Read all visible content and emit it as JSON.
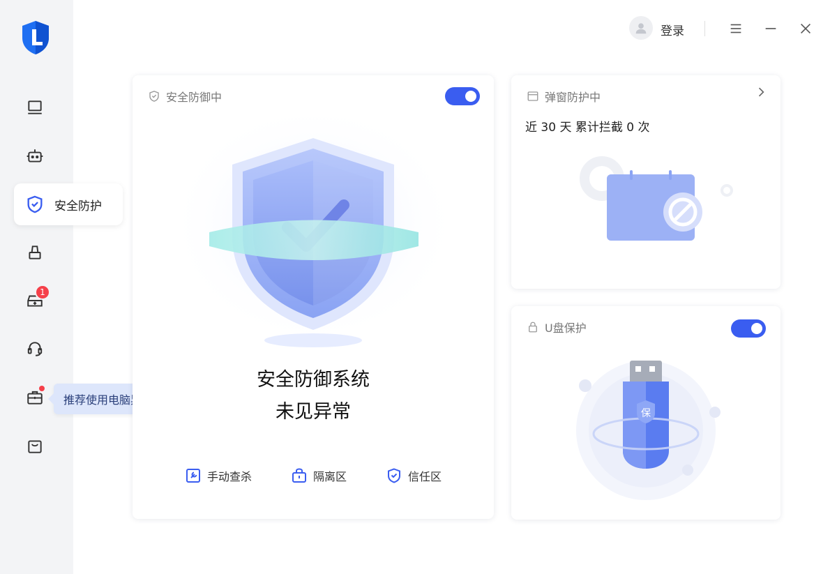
{
  "sidebar": {
    "active_label": "安全防护",
    "badge_count": "1",
    "tooltip": {
      "text": "推荐使用电脑异常修复",
      "close": "✕"
    }
  },
  "titlebar": {
    "login_label": "登录",
    "menu_icon": "menu-icon",
    "minimize_icon": "minimize-icon",
    "close_icon": "close-icon"
  },
  "main_card": {
    "header": "安全防御中",
    "toggle_on": true,
    "status_line1": "安全防御系统",
    "status_line2": "未见异常",
    "actions": [
      {
        "label": "手动查杀",
        "icon": "wrench-icon"
      },
      {
        "label": "隔离区",
        "icon": "lock-box-icon"
      },
      {
        "label": "信任区",
        "icon": "shield-check-icon"
      }
    ]
  },
  "popup_card": {
    "header": "弹窗防护中",
    "stat": "近 30 天 累计拦截 0 次"
  },
  "usb_card": {
    "header": "U盘保护",
    "toggle_on": true,
    "usb_label": "保"
  },
  "colors": {
    "accent": "#3a5df0",
    "badge": "#f5404a",
    "tooltip_bg": "#dde6fb",
    "sidebar_bg": "#f3f4f6"
  }
}
